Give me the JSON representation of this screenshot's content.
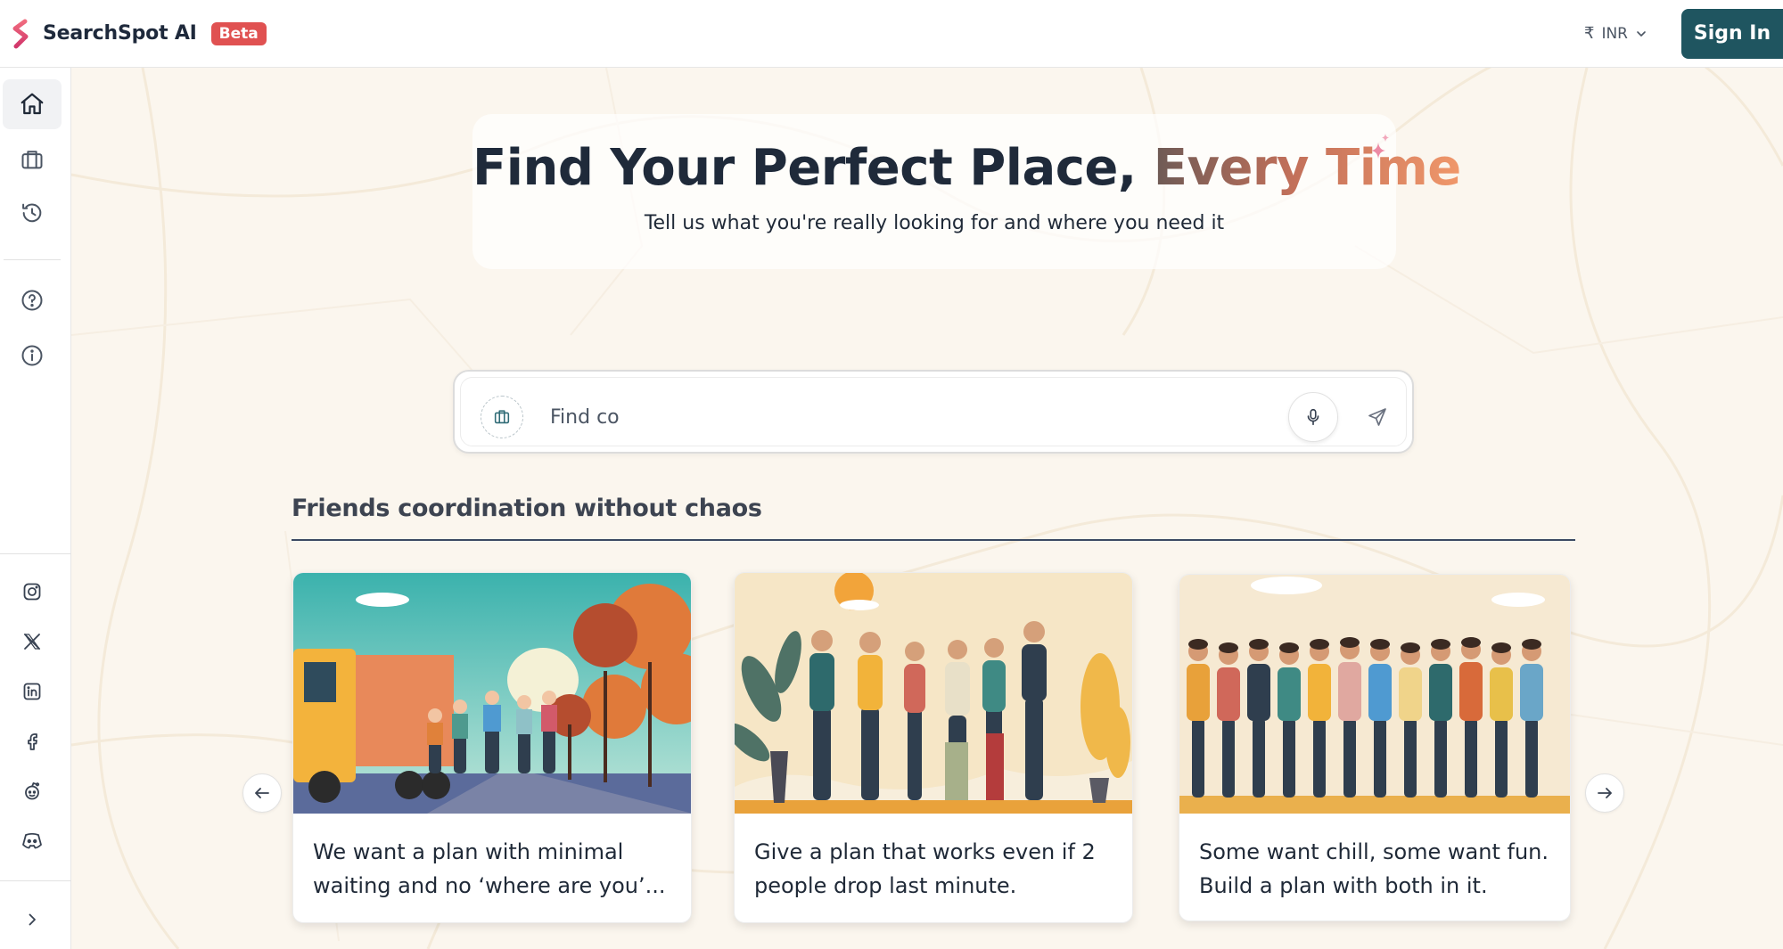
{
  "header": {
    "brand_name": "SearchSpot AI",
    "badge": "Beta",
    "currency_symbol": "₹",
    "currency": "INR",
    "signin_label": "Sign In"
  },
  "sidebar": {
    "nav": [
      "home-icon",
      "briefcase-icon",
      "history-icon"
    ],
    "help": [
      "help-icon",
      "info-icon"
    ],
    "social": [
      "instagram-icon",
      "x-icon",
      "linkedin-icon",
      "facebook-icon",
      "reddit-icon",
      "discord-icon"
    ],
    "expand": "chevron-right-icon"
  },
  "hero": {
    "title_main": "Find Your Perfect Place, ",
    "title_accent": "Every Time",
    "subtitle": "Tell us what you're really looking for and where you need it"
  },
  "search": {
    "value": "Find co",
    "placeholder": "Find co"
  },
  "section": {
    "title": "Friends coordination without chaos"
  },
  "cards": [
    {
      "text": "We want a plan with minimal waiting and no ‘where are you’..."
    },
    {
      "text": "Give a plan that works even if 2 people drop last minute."
    },
    {
      "text": "Some want chill, some want fun. Build a plan with both in it."
    }
  ],
  "colors": {
    "brand_badge": "#e05151",
    "signin_bg": "#1f5560",
    "accent_gradient": [
      "#6d5a55",
      "#f0976a"
    ]
  }
}
